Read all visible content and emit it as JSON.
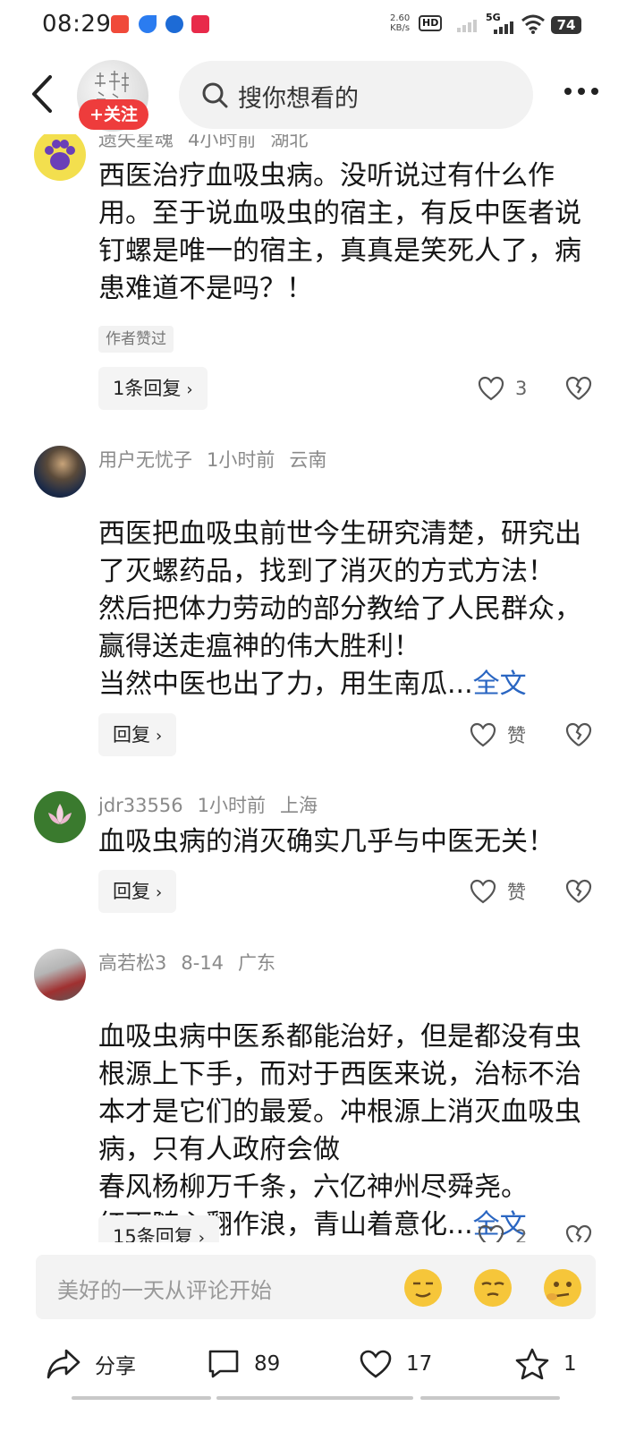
{
  "status_bar": {
    "time": "08:29",
    "net_speed_value": "2.60",
    "net_speed_unit": "KB/s",
    "hd_label": "HD",
    "network": "5G",
    "battery": "74"
  },
  "header": {
    "search_placeholder": "搜你想看的",
    "follow_label": "+关注"
  },
  "comments": [
    {
      "username": "遗失星魂",
      "time": "4小时前",
      "location": "湖北",
      "text": "西医治疗血吸虫病。没听说过有什么作用。至于说血吸虫的宿主，有反中医者说钉螺是唯一的宿主，真真是笑死人了，病患难道不是吗？！",
      "author_tag": "作者赞过",
      "reply_label": "1条回复",
      "like_count": "3"
    },
    {
      "username": "用户无忧子",
      "time": "1小时前",
      "location": "云南",
      "text": "西医把血吸虫前世今生研究清楚，研究出了灭螺药品，找到了消灭的方式方法！\n然后把体力劳动的部分教给了人民群众，赢得送走瘟神的伟大胜利！\n当然中医也出了力，用生南瓜...",
      "fulltext_label": "全文",
      "reply_label": "回复",
      "like_count": "赞"
    },
    {
      "username": "jdr33556",
      "time": "1小时前",
      "location": "上海",
      "text": "血吸虫病的消灭确实几乎与中医无关！",
      "reply_label": "回复",
      "like_count": "赞"
    },
    {
      "username": "高若松3",
      "time": "8-14",
      "location": "广东",
      "text": "血吸虫病中医系都能治好，但是都没有虫根源上下手，而对于西医来说，治标不治本才是它们的最爱。冲根源上消灭血吸虫病，只有人政府会做\n春风杨柳万千条，六亿神州尽舜尧。\n红雨随心翻作浪，青山着意化...",
      "fulltext_label": "全文",
      "reply_label": "15条回复",
      "like_count": "2"
    }
  ],
  "comment_input": {
    "placeholder": "美好的一天从评论开始"
  },
  "bottom_bar": {
    "share_label": "分享",
    "comment_count": "89",
    "like_count": "17",
    "favorite_count": "1"
  },
  "colors": {
    "follow_red": "#ee3c3c",
    "link_blue": "#2a66c2",
    "meta_gray": "#8a8a8a"
  }
}
